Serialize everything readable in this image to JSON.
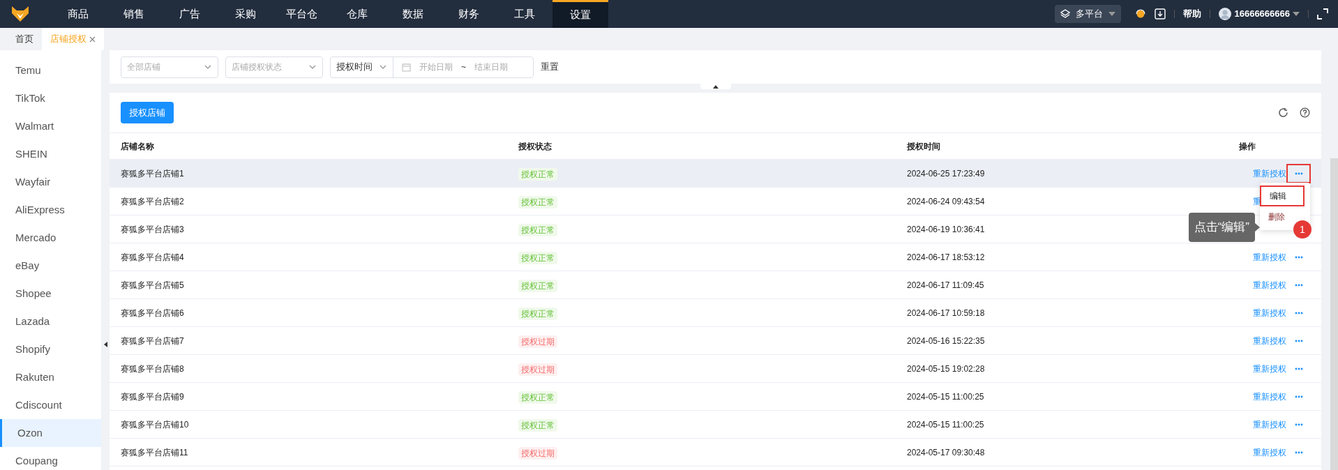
{
  "nav": {
    "items": [
      {
        "label": "商品",
        "selected": false
      },
      {
        "label": "销售",
        "selected": false
      },
      {
        "label": "广告",
        "selected": false
      },
      {
        "label": "采购",
        "selected": false
      },
      {
        "label": "平台仓",
        "selected": false
      },
      {
        "label": "仓库",
        "selected": false
      },
      {
        "label": "数据",
        "selected": false
      },
      {
        "label": "财务",
        "selected": false
      },
      {
        "label": "工具",
        "selected": false
      },
      {
        "label": "设置",
        "selected": true
      }
    ],
    "platform": "多平台",
    "help": "帮助",
    "user": "16666666666"
  },
  "tabs": [
    {
      "label": "首页",
      "selected": false
    },
    {
      "label": "店铺授权",
      "selected": true,
      "closable": true
    }
  ],
  "sidebar": {
    "items": [
      {
        "label": "Temu",
        "selected": false
      },
      {
        "label": "TikTok",
        "selected": false
      },
      {
        "label": "Walmart",
        "selected": false
      },
      {
        "label": "SHEIN",
        "selected": false
      },
      {
        "label": "Wayfair",
        "selected": false
      },
      {
        "label": "AliExpress",
        "selected": false
      },
      {
        "label": "Mercado",
        "selected": false
      },
      {
        "label": "eBay",
        "selected": false
      },
      {
        "label": "Shopee",
        "selected": false
      },
      {
        "label": "Lazada",
        "selected": false
      },
      {
        "label": "Shopify",
        "selected": false
      },
      {
        "label": "Rakuten",
        "selected": false
      },
      {
        "label": "Cdiscount",
        "selected": false
      },
      {
        "label": "Ozon",
        "selected": true
      },
      {
        "label": "Coupang",
        "selected": false
      }
    ]
  },
  "filters": {
    "store": {
      "placeholder": "全部店铺"
    },
    "status": {
      "placeholder": "店铺授权状态"
    },
    "time_type": "授权时间",
    "start": {
      "placeholder": "开始日期"
    },
    "separator": "~",
    "end": {
      "placeholder": "结束日期"
    },
    "reset": "重置"
  },
  "toolbar": {
    "authorize_button": "授权店铺"
  },
  "table": {
    "columns": [
      "店铺名称",
      "授权状态",
      "授权时间",
      "操作"
    ],
    "rows": [
      {
        "name": "赛狐多平台店铺1",
        "status": "授权正常",
        "kind": "normal",
        "time": "2024-06-25 17:23:49",
        "action": "重新授权",
        "more": true,
        "selected": true,
        "marked": true
      },
      {
        "name": "赛狐多平台店铺2",
        "status": "授权正常",
        "kind": "normal",
        "time": "2024-06-24 09:43:54",
        "action": "重",
        "selected": false
      },
      {
        "name": "赛狐多平台店铺3",
        "status": "授权正常",
        "kind": "normal",
        "time": "2024-06-19 10:36:41",
        "selected": false
      },
      {
        "name": "赛狐多平台店铺4",
        "status": "授权正常",
        "kind": "normal",
        "time": "2024-06-17 18:53:12",
        "action": "重新授权",
        "more": true,
        "selected": false,
        "marked": false
      },
      {
        "name": "赛狐多平台店铺5",
        "status": "授权正常",
        "kind": "normal",
        "time": "2024-06-17 11:09:45",
        "action": "重新授权",
        "more": true,
        "selected": false,
        "marked": false
      },
      {
        "name": "赛狐多平台店铺6",
        "status": "授权正常",
        "kind": "normal",
        "time": "2024-06-17 10:59:18",
        "action": "重新授权",
        "more": true,
        "selected": false,
        "marked": false
      },
      {
        "name": "赛狐多平台店铺7",
        "status": "授权过期",
        "kind": "expired",
        "time": "2024-05-16 15:22:35",
        "action": "重新授权",
        "more": true,
        "selected": false,
        "marked": false
      },
      {
        "name": "赛狐多平台店铺8",
        "status": "授权过期",
        "kind": "expired",
        "time": "2024-05-15 19:02:28",
        "action": "重新授权",
        "more": true,
        "selected": false,
        "marked": false
      },
      {
        "name": "赛狐多平台店铺9",
        "status": "授权正常",
        "kind": "normal",
        "time": "2024-05-15 11:00:25",
        "action": "重新授权",
        "more": true,
        "selected": false,
        "marked": false
      },
      {
        "name": "赛狐多平台店铺10",
        "status": "授权正常",
        "kind": "normal",
        "time": "2024-05-15 11:00:25",
        "action": "重新授权",
        "more": true,
        "selected": false,
        "marked": false
      },
      {
        "name": "赛狐多平台店铺11",
        "status": "授权过期",
        "kind": "expired",
        "time": "2024-05-17 09:30:48",
        "action": "重新授权",
        "more": true,
        "selected": false,
        "marked": false
      }
    ]
  },
  "menu": {
    "items": [
      {
        "label": "编辑",
        "marked": true
      },
      {
        "label": "删除",
        "marked": false
      }
    ]
  },
  "callout": {
    "text": "点击“编辑”",
    "step": "1"
  }
}
